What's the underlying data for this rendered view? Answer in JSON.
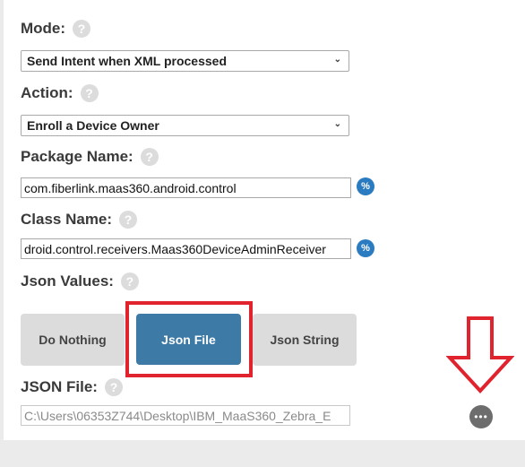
{
  "fields": {
    "mode": {
      "label": "Mode:",
      "value": "Send Intent when XML processed"
    },
    "action": {
      "label": "Action:",
      "value": "Enroll a Device Owner"
    },
    "package_name": {
      "label": "Package Name:",
      "value": "com.fiberlink.maas360.android.control"
    },
    "class_name": {
      "label": "Class Name:",
      "value": "droid.control.receivers.Maas360DeviceAdminReceiver"
    },
    "json_values": {
      "label": "Json Values:",
      "options": [
        "Do Nothing",
        "Json File",
        "Json String"
      ],
      "selected": "Json File"
    },
    "json_file": {
      "label": "JSON File:",
      "value": "C:\\Users\\06353Z744\\Desktop\\IBM_MaaS360_Zebra_E"
    }
  },
  "icons": {
    "help": "question-mark-icon",
    "variable": "percent-icon",
    "browse": "more-icon",
    "annotation": "down-arrow-icon"
  },
  "colors": {
    "selected_segment": "#3d7aa6",
    "unselected_segment": "#dcdcdc",
    "highlight": "#e0232d",
    "variable_button": "#2b7bc0"
  }
}
